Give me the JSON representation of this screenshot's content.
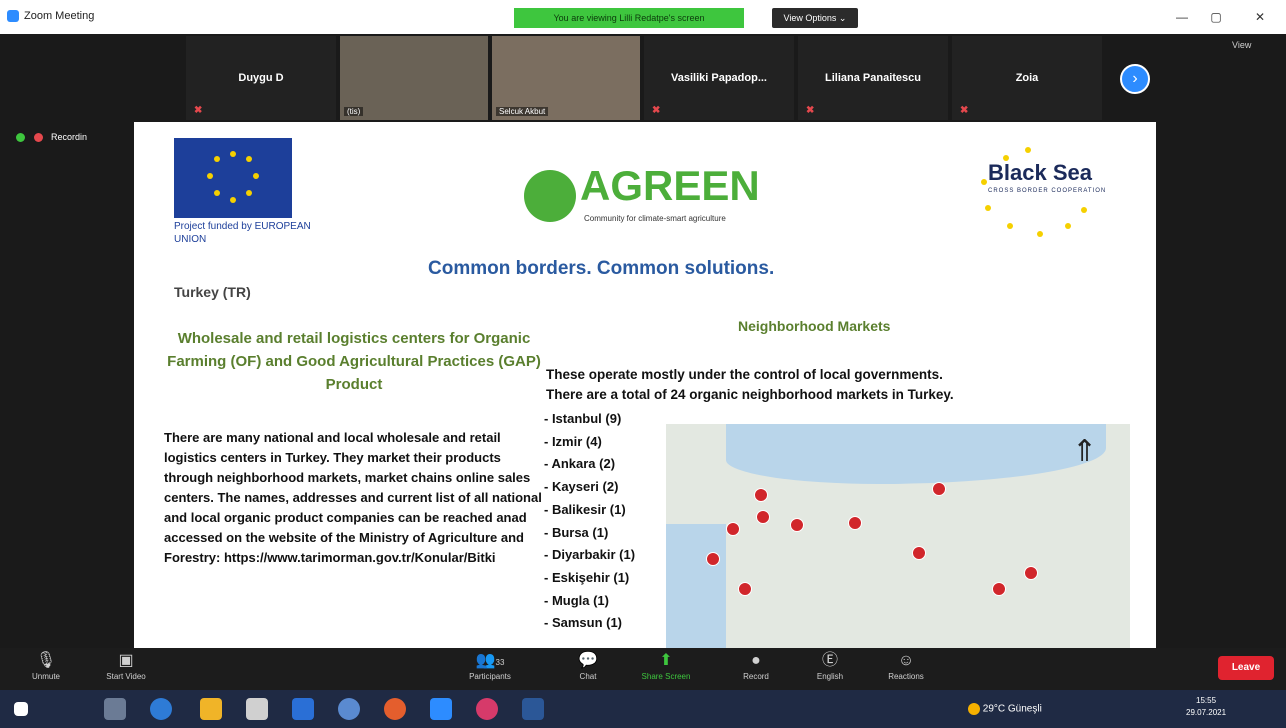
{
  "window": {
    "title": "Zoom Meeting",
    "banner": "You are viewing Lilli Redatpe's screen",
    "view_options": "View Options ⌄",
    "view_label": "View",
    "minimize": "—",
    "maximize": "▢",
    "close": "✕"
  },
  "participants": [
    {
      "name": "Duygu D"
    },
    {
      "name": "(tis)"
    },
    {
      "name": "Selcuk Akbut"
    },
    {
      "name": "Vasiliki Papadop..."
    },
    {
      "name": "Liliana Panaitescu"
    },
    {
      "name": "Zoia"
    }
  ],
  "status": {
    "recording": "Recordin"
  },
  "slide": {
    "eu_caption": "Project funded by EUROPEAN UNION",
    "agreen_name": "AGREEN",
    "agreen_tagline": "Community for climate-smart agriculture",
    "blacksea_name": "Black Sea",
    "blacksea_sub": "CROSS BORDER COOPERATION",
    "slogan": "Common borders. Common solutions.",
    "country": "Turkey (TR)",
    "left_heading": "Wholesale and retail logistics centers for Organic Farming (OF) and Good Agricultural Practices (GAP) Product",
    "left_body": "There are many national and local wholesale and retail logistics centers in Turkey. They market their products through neighborhood markets, market chains online sales centers. The names, addresses and current list of all national and local organic product companies can be reached anad accessed on the website of the Ministry of Agriculture and Forestry: https://www.tarimorman.gov.tr/Konular/Bitki",
    "right_heading": "Neighborhood Markets",
    "right_line1": "These operate mostly under the control of local governments.",
    "right_line2": "There are a total of 24 organic neighborhood markets in Turkey.",
    "cities": [
      "- Istanbul (9)",
      "- Izmir (4)",
      "- Ankara (2)",
      "- Kayseri (2)",
      "- Balikesir (1)",
      "- Bursa (1)",
      "- Diyarbakir (1)",
      "- Eskişehir (1)",
      "- Mugla (1)",
      "- Samsun (1)"
    ]
  },
  "controls": {
    "unmute": "Unmute",
    "start_video": "Start Video",
    "participants": "Participants",
    "participants_count": "33",
    "chat": "Chat",
    "share_screen": "Share Screen",
    "record": "Record",
    "english": "English",
    "reactions": "Reactions",
    "leave": "Leave"
  },
  "taskbar": {
    "weather": "29°C Güneşli",
    "time": "15:55",
    "date": "29.07.2021"
  },
  "colors": {
    "zoom_blue": "#2d8cff",
    "banner_green": "#3ec63e",
    "leave_red": "#e0232f",
    "agreen_green": "#4cae3a",
    "heading_green": "#5a7f2e",
    "slogan_blue": "#2a5aa0"
  },
  "icons": [
    "zoom-logo-icon",
    "mic-muted-icon",
    "video-off-icon",
    "participants-icon",
    "chat-icon",
    "share-screen-icon",
    "record-icon",
    "language-icon",
    "reactions-icon",
    "next-page-icon",
    "north-arrow-icon"
  ]
}
